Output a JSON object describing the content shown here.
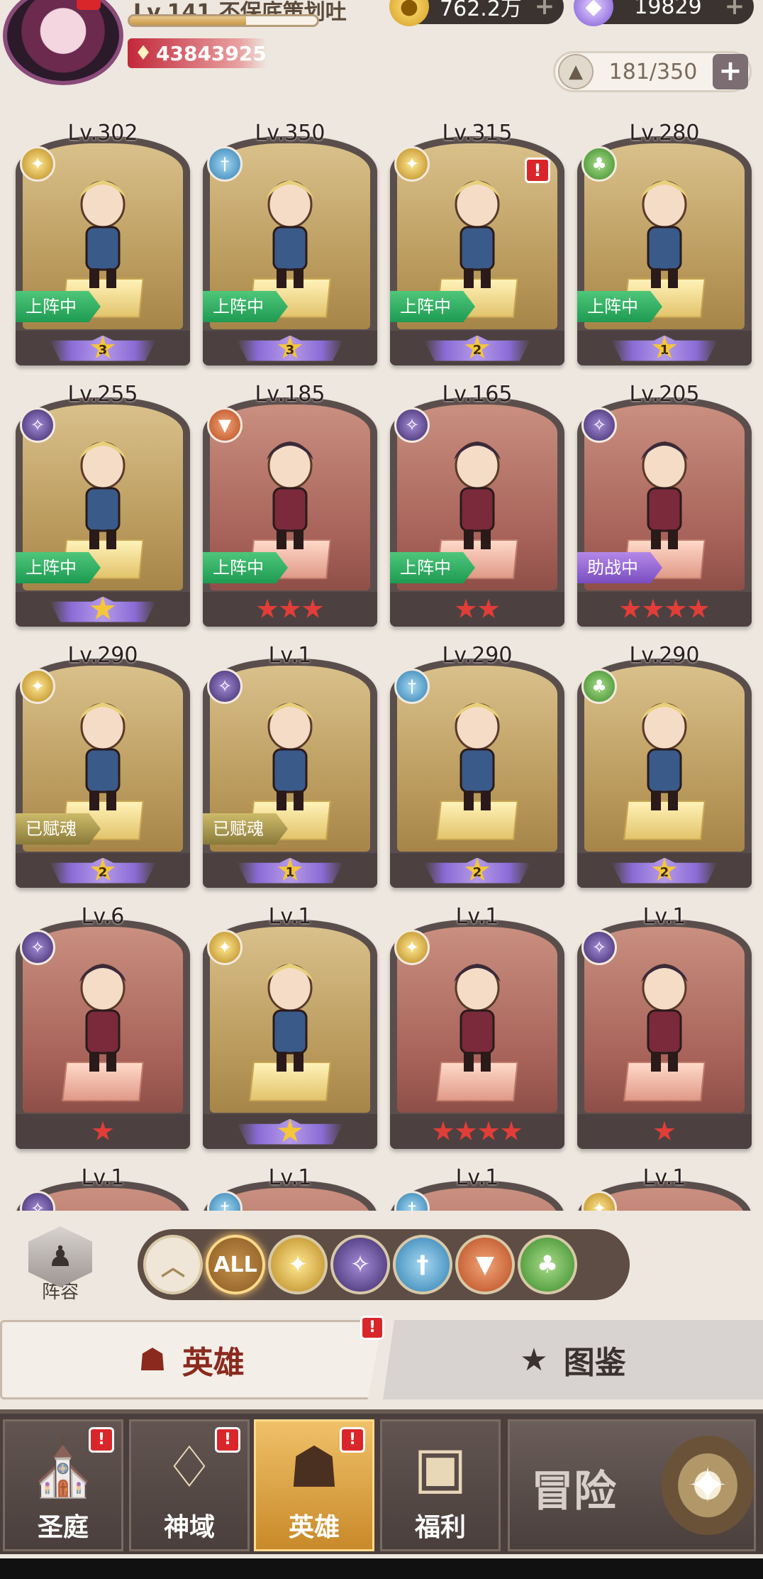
{
  "player": {
    "level_name": "Lv.141 不保底策划吐",
    "power": "43843925",
    "exp_fraction": 0.62
  },
  "currency": {
    "gold": "762.2万",
    "gems": "19829"
  },
  "roster_capacity": "181/350",
  "heroes": [
    {
      "level": "Lv.302",
      "faction": "holy",
      "status": "上阵中",
      "star_type": "wing",
      "stars": "3",
      "red_badge": false
    },
    {
      "level": "Lv.350",
      "faction": "order",
      "status": "上阵中",
      "star_type": "wing",
      "stars": "3",
      "red_badge": false
    },
    {
      "level": "Lv.315",
      "faction": "holy",
      "status": "上阵中",
      "star_type": "wing",
      "stars": "2",
      "red_badge": true
    },
    {
      "level": "Lv.280",
      "faction": "nature",
      "status": "上阵中",
      "star_type": "wing",
      "stars": "1",
      "red_badge": false
    },
    {
      "level": "Lv.255",
      "faction": "dark",
      "status": "上阵中",
      "star_type": "wing",
      "stars": "",
      "red_badge": false
    },
    {
      "level": "Lv.185",
      "faction": "beast",
      "status": "上阵中",
      "star_type": "red",
      "stars": 3,
      "red_badge": false
    },
    {
      "level": "Lv.165",
      "faction": "dark",
      "status": "上阵中",
      "star_type": "red",
      "stars": 2,
      "red_badge": false
    },
    {
      "level": "Lv.205",
      "faction": "dark",
      "status": "助战中",
      "star_type": "red",
      "stars": 4,
      "red_badge": false
    },
    {
      "level": "Lv.290",
      "faction": "holy",
      "status": "已赋魂",
      "star_type": "wing",
      "stars": "2",
      "red_badge": false
    },
    {
      "level": "Lv.1",
      "faction": "dark",
      "status": "已赋魂",
      "star_type": "wing",
      "stars": "1",
      "red_badge": false
    },
    {
      "level": "Lv.290",
      "faction": "order",
      "status": "",
      "star_type": "wing",
      "stars": "2",
      "red_badge": false
    },
    {
      "level": "Lv.290",
      "faction": "nature",
      "status": "",
      "star_type": "wing",
      "stars": "2",
      "red_badge": false
    },
    {
      "level": "Lv.6",
      "faction": "dark",
      "status": "",
      "star_type": "red",
      "stars": 1,
      "red_badge": false
    },
    {
      "level": "Lv.1",
      "faction": "holy",
      "status": "",
      "star_type": "wing",
      "stars": "",
      "red_badge": false
    },
    {
      "level": "Lv.1",
      "faction": "holy",
      "status": "",
      "star_type": "red",
      "stars": 4,
      "red_badge": false
    },
    {
      "level": "Lv.1",
      "faction": "dark",
      "status": "",
      "star_type": "red",
      "stars": 1,
      "red_badge": false
    },
    {
      "level": "Lv.1",
      "faction": "dark",
      "status": "",
      "star_type": "none",
      "stars": "",
      "red_badge": false
    },
    {
      "level": "Lv.1",
      "faction": "order",
      "status": "",
      "star_type": "none",
      "stars": "",
      "red_badge": false
    },
    {
      "level": "Lv.1",
      "faction": "order",
      "status": "",
      "star_type": "none",
      "stars": "",
      "red_badge": false
    },
    {
      "level": "Lv.1",
      "faction": "holy",
      "status": "",
      "star_type": "none",
      "stars": "",
      "red_badge": false
    }
  ],
  "lineup_label": "阵容",
  "filters": [
    {
      "name": "collapse",
      "label": "︿"
    },
    {
      "name": "all",
      "label": "ALL"
    },
    {
      "name": "holy",
      "label": "✦"
    },
    {
      "name": "dark",
      "label": "✧"
    },
    {
      "name": "order",
      "label": "†"
    },
    {
      "name": "beast",
      "label": "▼"
    },
    {
      "name": "nature",
      "label": "♣"
    }
  ],
  "tabs": {
    "heroes": "英雄",
    "codex": "图鉴"
  },
  "nav": {
    "court": "圣庭",
    "divine": "神域",
    "heroes": "英雄",
    "welfare": "福利",
    "adventure": "冒险"
  },
  "colors": {
    "status_green": "#1e9a52",
    "status_purple": "#7a4ec0",
    "status_olive": "#8a7a3a",
    "badge_red": "#d9262b"
  }
}
